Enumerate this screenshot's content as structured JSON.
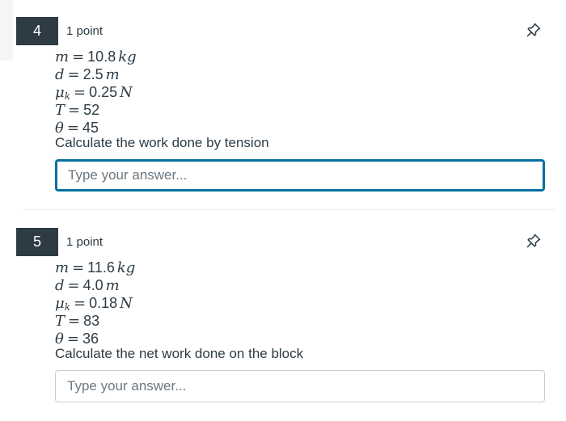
{
  "questions": [
    {
      "number": "4",
      "points": "1 point",
      "pin_icon": "pin-icon",
      "vars": {
        "m": {
          "sym": "m",
          "value": "10.8",
          "unit": "kg"
        },
        "d": {
          "sym": "d",
          "value": "2.5",
          "unit": "m"
        },
        "mu": {
          "sym": "μ",
          "sub": "k",
          "value": "0.25",
          "unit": "N"
        },
        "T": {
          "sym": "T",
          "value": "52"
        },
        "theta": {
          "sym": "θ",
          "value": "45"
        }
      },
      "prompt": "Calculate the work done by tension",
      "answer": {
        "value": "",
        "placeholder": "Type your answer...",
        "focused": true
      }
    },
    {
      "number": "5",
      "points": "1 point",
      "pin_icon": "pin-icon",
      "vars": {
        "m": {
          "sym": "m",
          "value": "11.6",
          "unit": "kg"
        },
        "d": {
          "sym": "d",
          "value": "4.0",
          "unit": "m"
        },
        "mu": {
          "sym": "μ",
          "sub": "k",
          "value": "0.18",
          "unit": "N"
        },
        "T": {
          "sym": "T",
          "value": "83"
        },
        "theta": {
          "sym": "θ",
          "value": "36"
        }
      },
      "prompt": "Calculate the net work done on the block",
      "answer": {
        "value": "",
        "placeholder": "Type your answer...",
        "focused": false
      }
    }
  ],
  "colors": {
    "badge_bg": "#2d3b45",
    "text": "#2d3b45",
    "focus": "#0770a3",
    "border": "#c7cdd1"
  }
}
